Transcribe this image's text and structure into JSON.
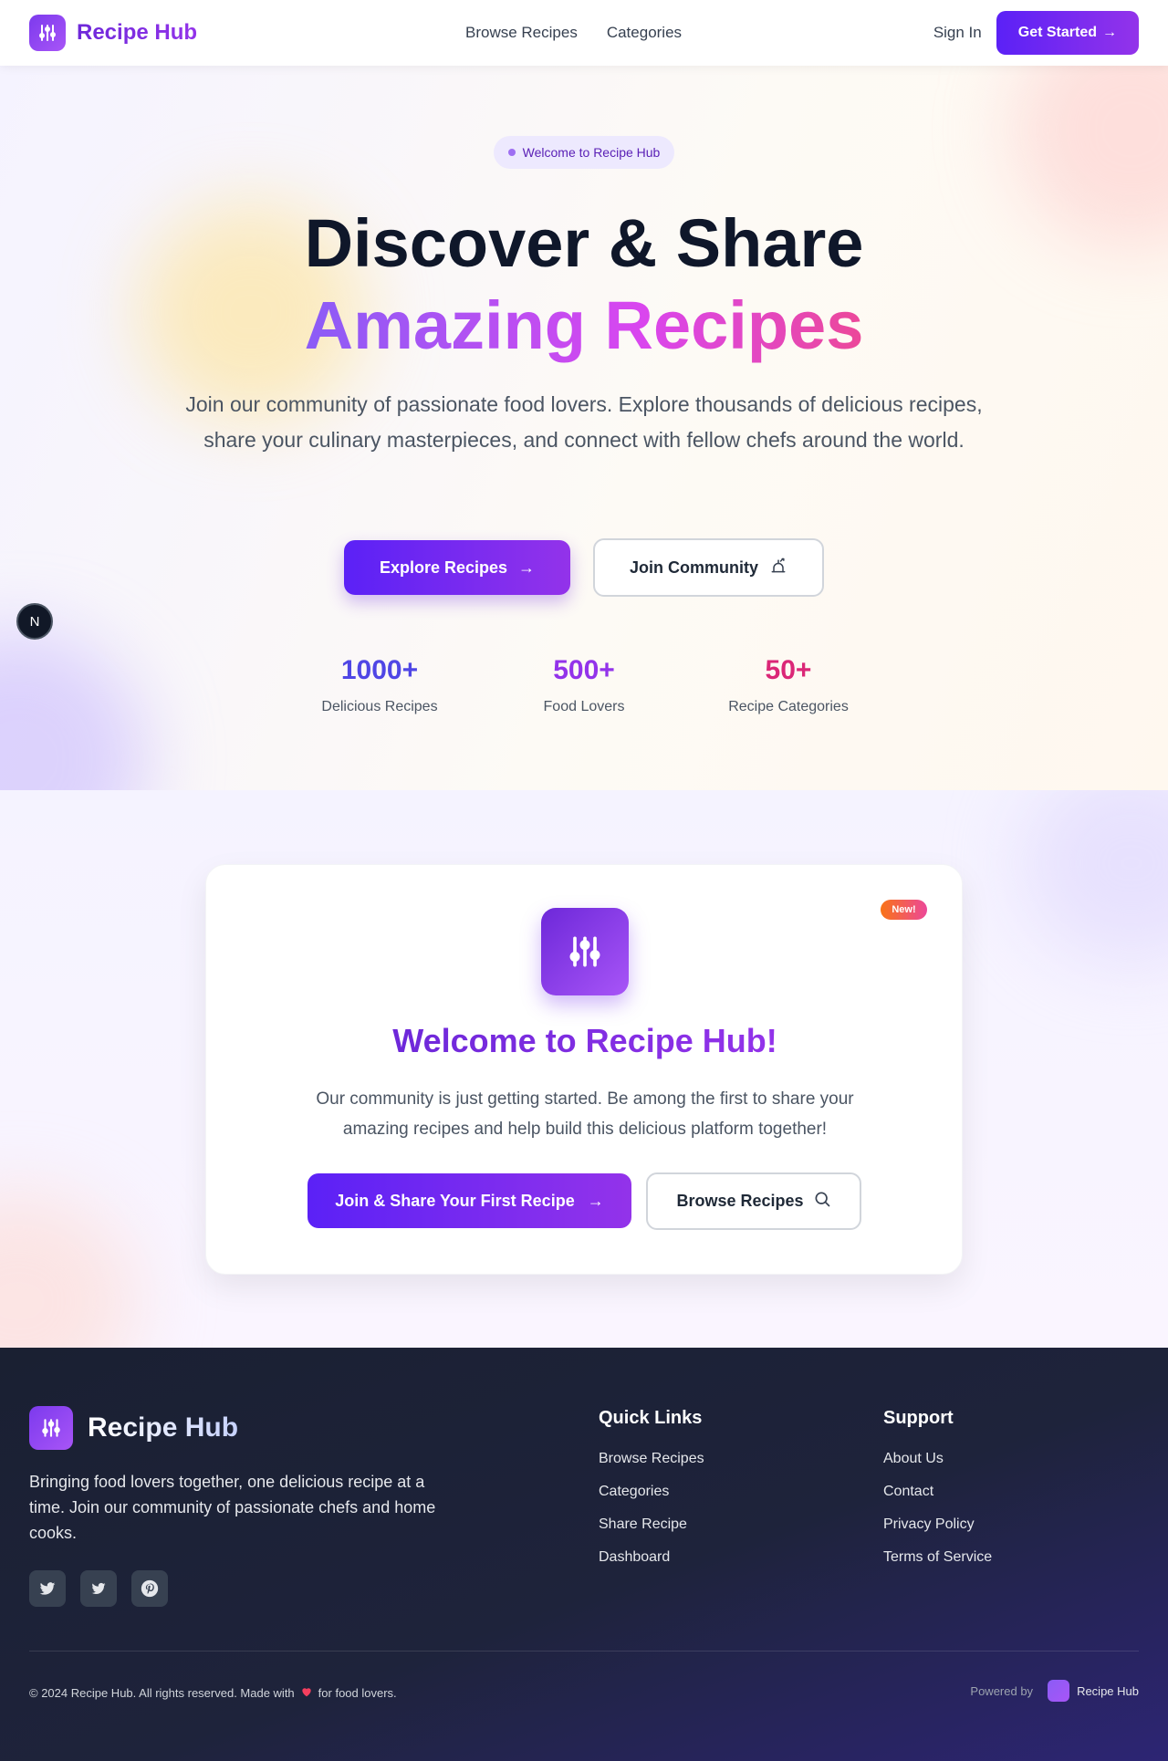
{
  "nav": {
    "brand": "Recipe Hub",
    "links": [
      "Browse Recipes",
      "Categories"
    ],
    "sign_in": "Sign In",
    "get_started": "Get Started",
    "get_started_arrow": "→"
  },
  "hero": {
    "badge": "Welcome to Recipe Hub",
    "title_line1": "Discover & Share",
    "title_line2": "Amazing Recipes",
    "description": "Join our community of passionate food lovers. Explore thousands of delicious recipes, share your culinary masterpieces, and connect with fellow chefs around the world.",
    "btn_explore": "Explore Recipes",
    "btn_join": "Join Community",
    "arrow": "→",
    "stats": [
      {
        "value": "1000+",
        "label": "Delicious Recipes",
        "color": "#4f46e5"
      },
      {
        "value": "500+",
        "label": "Food Lovers",
        "color": "#9333ea"
      },
      {
        "value": "50+",
        "label": "Recipe Categories",
        "color": "#db2777"
      }
    ]
  },
  "dev_badge": "N",
  "welcome": {
    "new_badge": "New!",
    "title": "Welcome to Recipe Hub!",
    "description": "Our community is just getting started. Be among the first to share your amazing recipes and help build this delicious platform together!",
    "btn_join": "Join & Share Your First Recipe",
    "btn_browse": "Browse Recipes",
    "arrow": "→"
  },
  "footer": {
    "brand": "Recipe Hub",
    "description": "Bringing food lovers together, one delicious recipe at a time. Join our community of passionate chefs and home cooks.",
    "socials": [
      "twitter-icon",
      "twitter-icon",
      "pinterest-icon"
    ],
    "quick_links": {
      "title": "Quick Links",
      "items": [
        "Browse Recipes",
        "Categories",
        "Share Recipe",
        "Dashboard"
      ]
    },
    "support": {
      "title": "Support",
      "items": [
        "About Us",
        "Contact",
        "Privacy Policy",
        "Terms of Service"
      ]
    },
    "copyright_pre": "© 2024 Recipe Hub. All rights reserved. Made with",
    "copyright_post": "for food lovers.",
    "powered_by": "Powered by",
    "powered_name": "Recipe Hub"
  },
  "colors": {
    "primary": "#6d28d9",
    "accent": "#9333ea",
    "pink": "#ec4899",
    "footer_bg": "#1e233b"
  }
}
